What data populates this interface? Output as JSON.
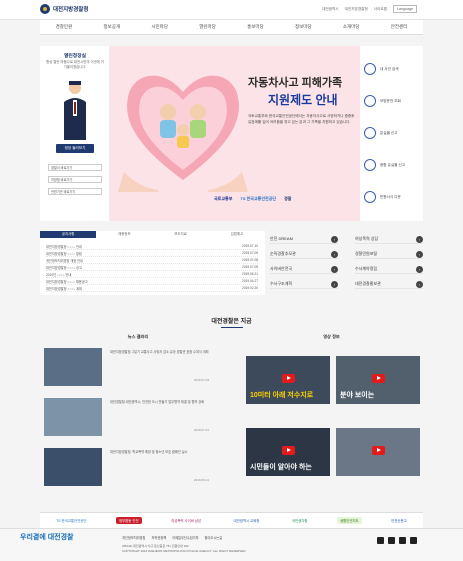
{
  "header": {
    "logo_name": "대전지방경찰청",
    "util_links": [
      "대전광역시",
      "대전지방경찰청",
      "사이트맵"
    ],
    "language": "Language"
  },
  "gnb": [
    "경찰민원",
    "정보공개",
    "시민마당",
    "열린마당",
    "홍보마당",
    "정보마당",
    "소개마당",
    "안전센터"
  ],
  "left_panel": {
    "title": "열린청장실",
    "desc": "항상 열린 마음으로 대전시민의 이곳에 귀 기울이겠습니다.",
    "button": "청장 둘러보기",
    "selects": [
      "경찰서 바로가기",
      "지방청 바로가기",
      "관련기관 바로가기"
    ]
  },
  "banner": {
    "title1": "자동차사고 피해가족",
    "title2": "지원제도 안내",
    "desc": "국토교통부와 한국교통안전공단에서는 자동차사고로 사망하거나 중증후유장애를 입어 어려움을 겪고 있는 분과 그 가족을 지원하고 있습니다.",
    "logos": [
      "국토교통부",
      "TS 한국교통안전공단",
      "경찰"
    ]
  },
  "quick_menu": [
    "내 사건 검색",
    "모범운전 조회",
    "분실물 신고",
    "종합 유실물 신고",
    "민원서식 다운"
  ],
  "notice": {
    "tabs": [
      "공지사항",
      "채용정보",
      "보도자료",
      "입법예고"
    ],
    "rows": [
      {
        "title": "대전지방경찰청 ○○○○ 안내",
        "date": "2019.07.10"
      },
      {
        "title": "대전지방경찰청 ○○○○ 알림",
        "date": "2019.07.09"
      },
      {
        "title": "개인정보처리방침 개정 안내",
        "date": "2019.07.08"
      },
      {
        "title": "대전지방경찰청 ○○○○ 공고",
        "date": "2019.07.05"
      },
      {
        "title": "2019년 ○○○○ 안내",
        "date": "2019.06.21"
      },
      {
        "title": "대전지방경찰청 ○○○○ 채용공고",
        "date": "2019.04.27"
      },
      {
        "title": "대전지방경찰청 ○○○○ 계획",
        "date": "2019.02.20"
      }
    ]
  },
  "quick_links": [
    "안전 DREAM",
    "여성폭력 상담",
    "순직경찰추모관",
    "경찰민원포털",
    "사이버안전국",
    "수사계약정립",
    "수사구조개혁",
    "대전경찰홍보관"
  ],
  "section_title": "대전경찰은 지금",
  "gallery": {
    "head": "뉴스 갤러리",
    "items": [
      {
        "text": "대전지방경찰청, 2분기 교통사고 사망자 감소 유공 경찰관 표창 수여식 개최",
        "date": "2019.07.03"
      },
      {
        "text": "대전경찰청-대전광역시, 안전한 도시 만들기 업무협약 체결 및 협력 강화",
        "date": "2019.07.01"
      },
      {
        "text": "대전지방경찰청, 학교폭력 예방 및 청소년 보호 캠페인 실시",
        "date": "2019.06.21"
      }
    ]
  },
  "video": {
    "head": "영상 정보",
    "items": [
      {
        "line1": "10미터 아래 저수지로",
        "line2": "뛰어든 경찰관",
        "top": "월드 위에 저수지로"
      },
      {
        "line1": "분야 보이는",
        "line2": "",
        "top": "보은 사람이 다 할 있는"
      },
      {
        "line1": "시민들이 알아야 하는",
        "line2": "교통법규 위반 신고 7가지",
        "top": ""
      },
      {
        "line1": "",
        "line2": "",
        "top": ""
      }
    ]
  },
  "partners": [
    "TS 한국교통안전공단",
    "정부합동 안전",
    "여성폭력 사이버 상담",
    "대전광역시 교육청",
    "국민생각함",
    "생활안전지도",
    "안전신문고"
  ],
  "footer": {
    "logo": "우리곁에 대전경찰",
    "links": [
      "개인정보처리방침",
      "저작권정책",
      "이메일무단수집거부",
      "찾아오시는길"
    ],
    "address": "(35242) 대전광역시 서구 둔산중로 78 | 민원안내 182",
    "copyright": "COPYRIGHT 2016 DAEJEON METROPOLITAN POLICE AGENCY. ALL RIGHT RESERVED"
  },
  "colors": {
    "primary": "#1f3a70",
    "banner_bg": "#fce3e7",
    "accent": "#1a3b9e"
  }
}
